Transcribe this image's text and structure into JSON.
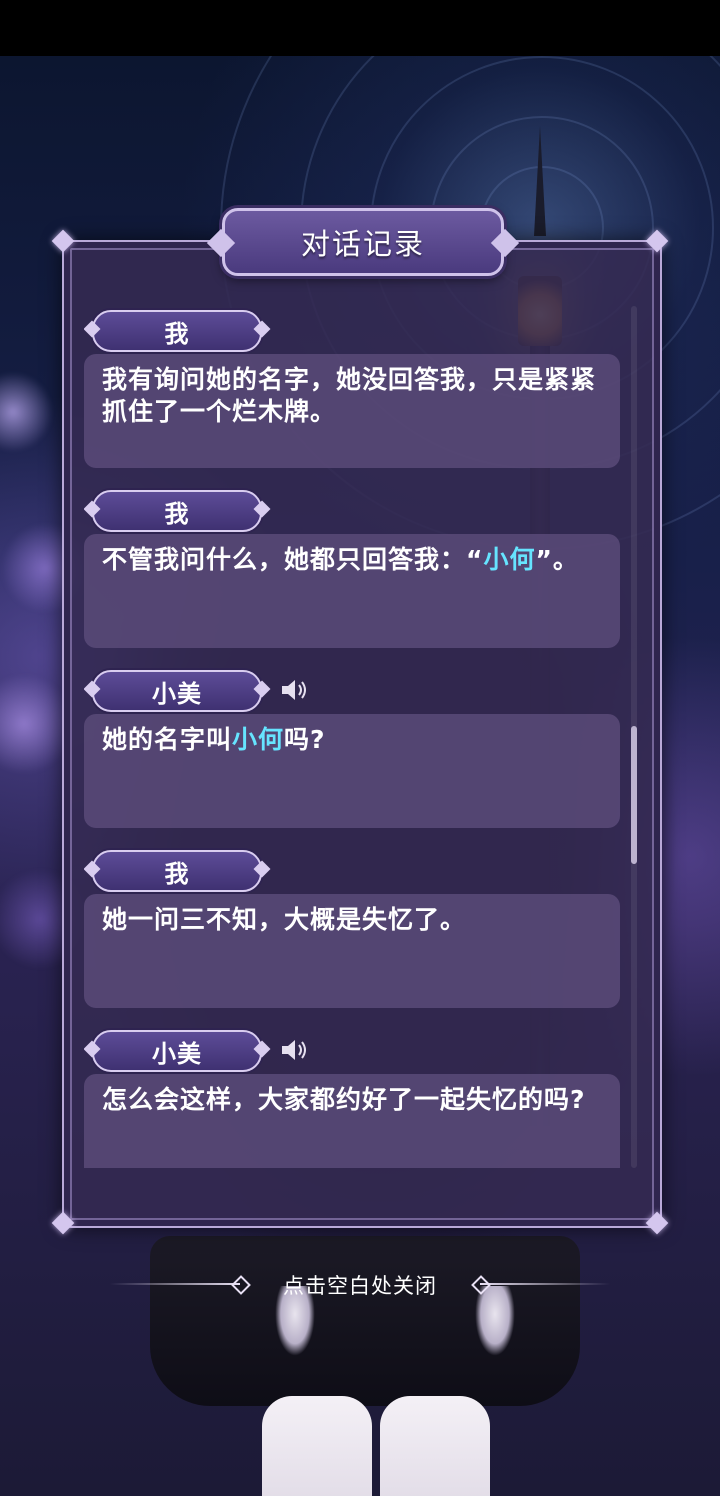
{
  "dialog_log": {
    "title": "对话记录",
    "close_hint": "点击空白处关闭",
    "scroll_position": 0.58,
    "scroll_visible_fraction": 0.16,
    "entries": [
      {
        "speaker": "我",
        "has_voice": false,
        "text_parts": [
          {
            "text": "我有询问她的名字，她没回答我，只是紧紧抓住了一个烂木牌。",
            "highlight": false
          }
        ]
      },
      {
        "speaker": "我",
        "has_voice": false,
        "text_parts": [
          {
            "text": "不管我问什么，她都只回答我：“",
            "highlight": false
          },
          {
            "text": "小何",
            "highlight": true
          },
          {
            "text": "”。",
            "highlight": false
          }
        ]
      },
      {
        "speaker": "小美",
        "has_voice": true,
        "text_parts": [
          {
            "text": "她的名字叫",
            "highlight": false
          },
          {
            "text": "小何",
            "highlight": true
          },
          {
            "text": "吗?",
            "highlight": false
          }
        ]
      },
      {
        "speaker": "我",
        "has_voice": false,
        "text_parts": [
          {
            "text": "她一问三不知，大概是失忆了。",
            "highlight": false
          }
        ]
      },
      {
        "speaker": "小美",
        "has_voice": true,
        "text_parts": [
          {
            "text": "怎么会这样，大家都约好了一起失忆的吗?",
            "highlight": false
          }
        ]
      }
    ]
  },
  "icons": {
    "voice": "speaker-volume-icon",
    "corner": "diamond-ornament"
  },
  "colors": {
    "panel": "#342a52",
    "bubble": "#5c4c7a",
    "highlight": "#66e4ff",
    "title_plate": "#5b4a90"
  }
}
